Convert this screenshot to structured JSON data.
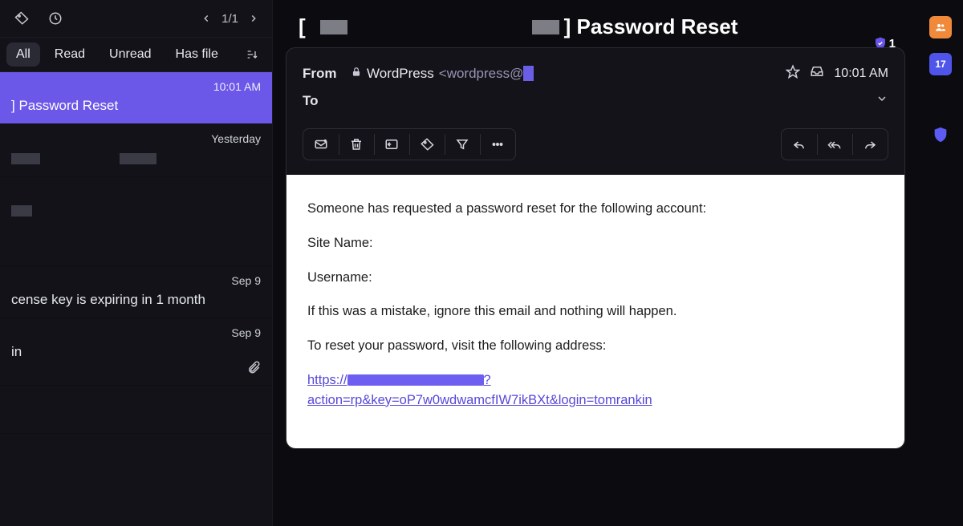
{
  "toolbar_icons": {
    "tag": "tag-icon",
    "clock": "clock-icon"
  },
  "pager": {
    "label": "1/1"
  },
  "filters": {
    "all": "All",
    "read": "Read",
    "unread": "Unread",
    "has_file": "Has file"
  },
  "messages": [
    {
      "time": "10:01 AM",
      "subject": "] Password Reset",
      "selected": true
    },
    {
      "time": "Yesterday",
      "subject": "",
      "selected": false
    },
    {
      "time": "",
      "subject": "",
      "selected": false,
      "blank": true
    },
    {
      "time": "Sep 9",
      "subject": "cense key is expiring in 1 month",
      "selected": false
    },
    {
      "time": "Sep 9",
      "subject": "in",
      "selected": false,
      "attach": true
    }
  ],
  "reader": {
    "title_suffix": "Password Reset",
    "badge_count": "1",
    "from_label": "From",
    "to_label": "To",
    "sender_name": "WordPress",
    "sender_addr_prefix": "<wordpress@",
    "time": "10:01 AM"
  },
  "body": {
    "p1": "Someone has requested a password reset for the following account:",
    "p2": "Site Name:",
    "p3": "Username:",
    "p4": "If this was a mistake, ignore this email and nothing will happen.",
    "p5": "To reset your password, visit the following address:",
    "link_prefix": "https://",
    "link_q": "?",
    "link_suffix": "action=rp&key=oP7w0wdwamcfIW7ikBXt&login=tomrankin"
  },
  "rail": {
    "cal": "17"
  }
}
